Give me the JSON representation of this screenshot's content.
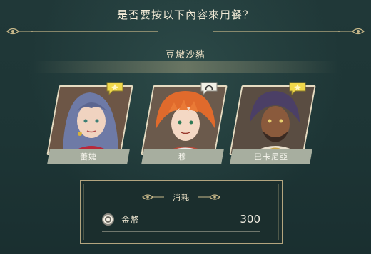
{
  "dialog": {
    "title": "是否要按以下內容來用餐？",
    "dish_name": "豆燉沙豬"
  },
  "characters": [
    {
      "name": "蕾婕",
      "badge_icon": "star-speech-icon",
      "hair_color": "#6e7aa6"
    },
    {
      "name": "穆",
      "badge_icon": "headphones-speech-icon",
      "hair_color": "#e06a2c"
    },
    {
      "name": "巴卡尼亞",
      "badge_icon": "star-speech-icon",
      "hair_color": "#4b3f66"
    }
  ],
  "cost": {
    "label": "消耗",
    "currency": "金幣",
    "amount": "300"
  },
  "colors": {
    "background": "#213a3a",
    "accent_gold": "#c9b98a",
    "name_plate": "#a7ae9f",
    "badge_yellow": "#f0d84a"
  }
}
